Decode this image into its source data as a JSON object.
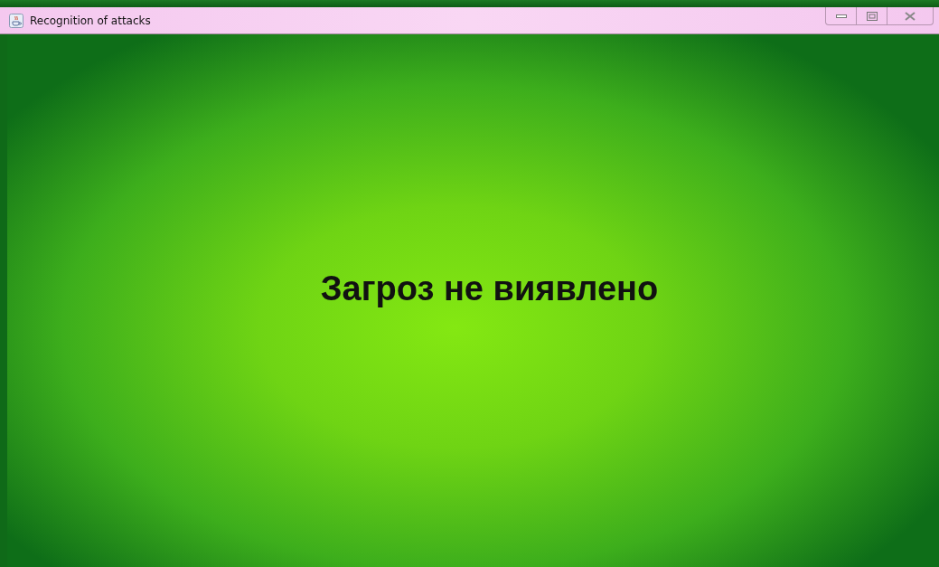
{
  "window": {
    "title": "Recognition of attacks"
  },
  "status": {
    "message": "Загроз не виявлено"
  }
}
